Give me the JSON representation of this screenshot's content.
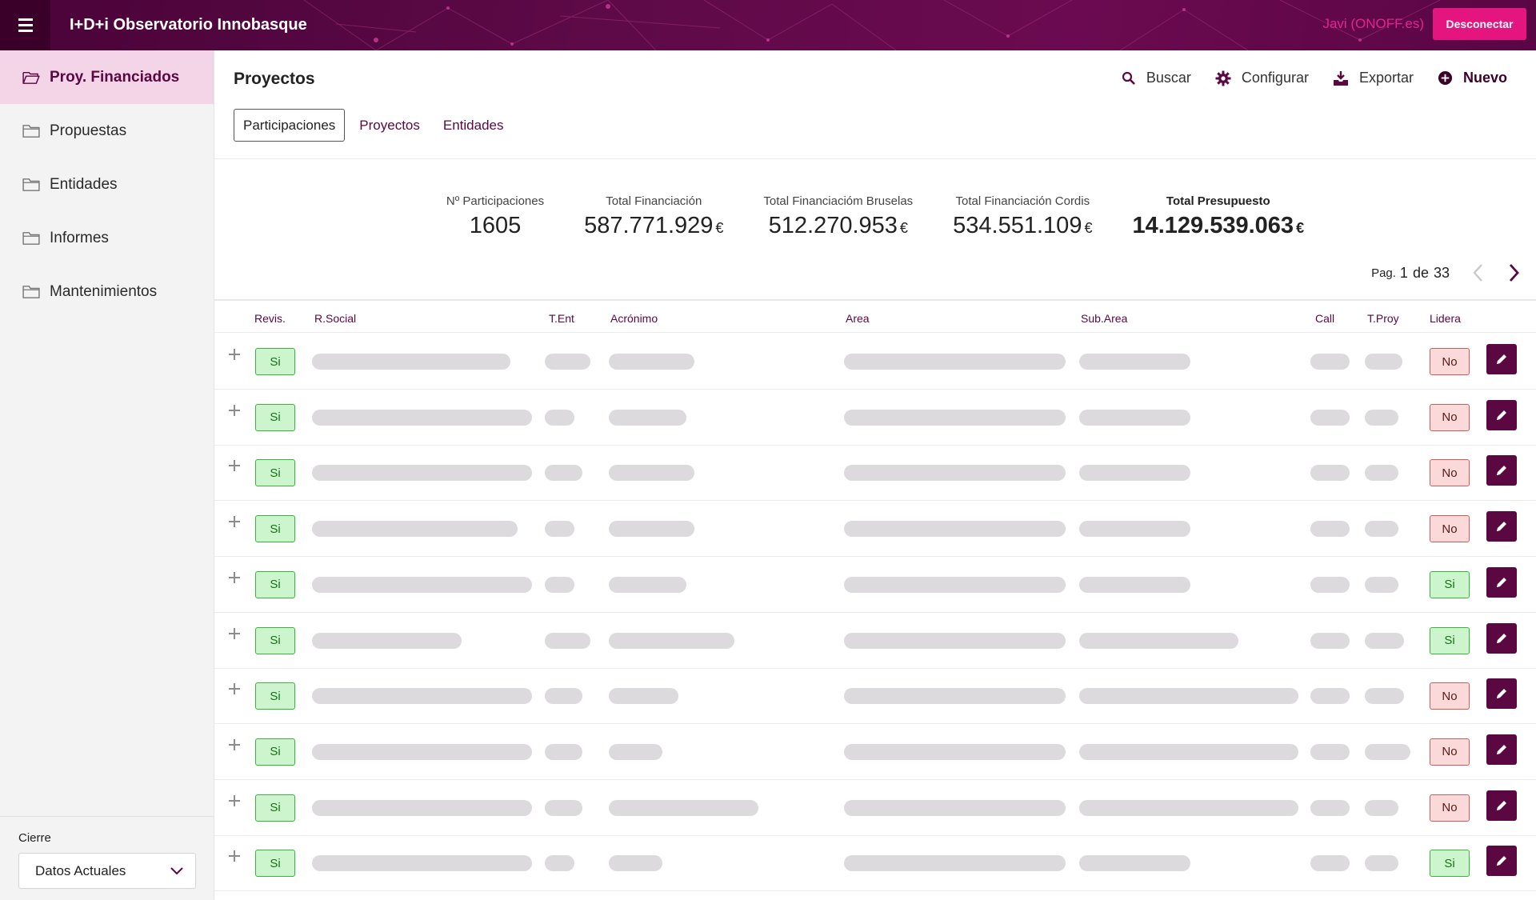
{
  "header": {
    "app_title": "I+D+i Observatorio Innobasque",
    "user": "Javi (ONOFF.es)",
    "logout_label": "Desconectar",
    "brand_color": "#5e0a48",
    "accent_color": "#e5157f"
  },
  "sidebar": {
    "items": [
      {
        "label": "Proy. Financiados",
        "icon": "folder-open-icon",
        "active": true
      },
      {
        "label": "Propuestas",
        "icon": "folder-icon",
        "active": false
      },
      {
        "label": "Entidades",
        "icon": "folder-icon",
        "active": false
      },
      {
        "label": "Informes",
        "icon": "folder-icon",
        "active": false
      },
      {
        "label": "Mantenimientos",
        "icon": "folder-icon",
        "active": false
      }
    ],
    "cierre": {
      "label": "Cierre",
      "selected": "Datos Actuales"
    }
  },
  "main": {
    "title": "Proyectos",
    "actions": [
      {
        "label": "Buscar",
        "icon": "search-icon"
      },
      {
        "label": "Configurar",
        "icon": "gear-icon"
      },
      {
        "label": "Exportar",
        "icon": "download-icon"
      },
      {
        "label": "Nuevo",
        "icon": "plus-circle-icon"
      }
    ],
    "tabs": [
      {
        "label": "Participaciones",
        "active": true
      },
      {
        "label": "Proyectos",
        "active": false
      },
      {
        "label": "Entidades",
        "active": false
      }
    ],
    "stats": [
      {
        "label": "Nº Participaciones",
        "value": "1605",
        "currency": ""
      },
      {
        "label": "Total Financiación",
        "value": "587.771.929",
        "currency": "€"
      },
      {
        "label": "Total Financiacióm Bruselas",
        "value": "512.270.953",
        "currency": "€"
      },
      {
        "label": "Total Financiación Cordis",
        "value": "534.551.109",
        "currency": "€"
      },
      {
        "label": "Total Presupuesto",
        "value": "14.129.539.063",
        "currency": "€"
      }
    ],
    "pager": {
      "label": "Pag.",
      "current": "1",
      "of": "de",
      "total": "33"
    },
    "columns": [
      "Revis.",
      "R.Social",
      "T.Ent",
      "Acrónimo",
      "Area",
      "Sub.Area",
      "Call",
      "T.Proy",
      "Lidera"
    ],
    "rows": [
      {
        "revis": "Si",
        "lidera": "No"
      },
      {
        "revis": "Si",
        "lidera": "No"
      },
      {
        "revis": "Si",
        "lidera": "No"
      },
      {
        "revis": "Si",
        "lidera": "No"
      },
      {
        "revis": "Si",
        "lidera": "Si"
      },
      {
        "revis": "Si",
        "lidera": "Si"
      },
      {
        "revis": "Si",
        "lidera": "No"
      },
      {
        "revis": "Si",
        "lidera": "No"
      },
      {
        "revis": "Si",
        "lidera": "No"
      },
      {
        "revis": "Si",
        "lidera": "Si"
      }
    ]
  }
}
